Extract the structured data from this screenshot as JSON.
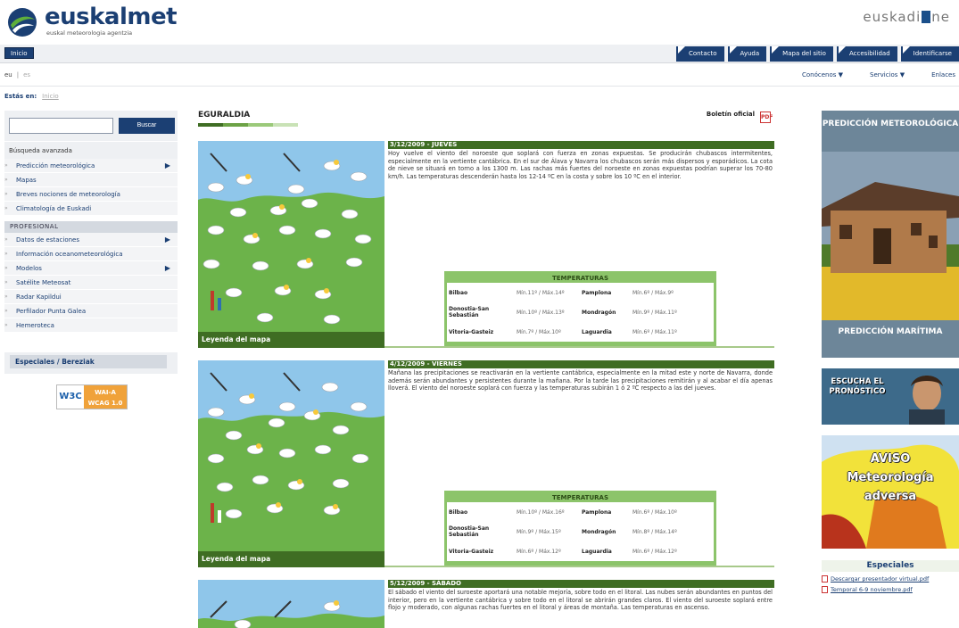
{
  "header": {
    "brand": "euskalmet",
    "tagline": "euskal meteorologia agentzia",
    "partner": "euskadi",
    "partner_tail": "ne"
  },
  "topbar": {
    "home_label": "Inicio",
    "nav": [
      "Contacto",
      "Ayuda",
      "Mapa del sitio",
      "Accesibilidad",
      "Identificarse"
    ]
  },
  "lang": {
    "current": "eu",
    "other": "es"
  },
  "subnav": [
    {
      "label": "Conócenos",
      "dropdown": true
    },
    {
      "label": "Servicios",
      "dropdown": true
    },
    {
      "label": "Enlaces",
      "dropdown": false
    }
  ],
  "breadcrumb": {
    "prefix": "Estás en:",
    "item": "Inicio"
  },
  "sidebar": {
    "search_placeholder": "",
    "search_button": "Buscar",
    "advanced_search": "Búsqueda avanzada",
    "menu": [
      {
        "label": "Predicción meteorológica",
        "has_submenu": true
      },
      {
        "label": "Mapas",
        "has_submenu": false
      },
      {
        "label": "Breves nociones de meteorología",
        "has_submenu": false
      },
      {
        "label": "Climatología de Euskadi",
        "has_submenu": false
      }
    ],
    "professional_heading": "PROFESIONAL",
    "professional_menu": [
      {
        "label": "Datos de estaciones",
        "has_submenu": true
      },
      {
        "label": "Información oceanometeorológica",
        "has_submenu": false
      },
      {
        "label": "Modelos",
        "has_submenu": true
      },
      {
        "label": "Satélite Meteosat",
        "has_submenu": false
      },
      {
        "label": "Radar Kapildui",
        "has_submenu": false
      },
      {
        "label": "Perfilador Punta Galea",
        "has_submenu": false
      },
      {
        "label": "Hemeroteca",
        "has_submenu": false
      }
    ],
    "especiales_heading": "Especiales / Bereziak",
    "wai_badge": {
      "w3c": "W3C",
      "level": "WAI-A",
      "version": "WCAG 1.0"
    }
  },
  "main": {
    "title": "EGURALDIA",
    "official_bulletin": "Boletín oficial",
    "map_legend": "Leyenda del mapa",
    "temps_heading": "TEMPERATURAS",
    "days": [
      {
        "date": "3/12/2009 - JUEVES",
        "text": "Hoy vuelve el viento del noroeste que soplará con fuerza en zonas expuestas. Se producirán chubascos intermitentes, especialmente en la vertiente cantábrica. En el sur de Álava y Navarra los chubascos serán más dispersos y esporádicos. La cota de nieve se situará en torno a los 1300 m. Las rachas más fuertes del noroeste en zonas expuestas podrían superar los 70-80 km/h. Las temperaturas descenderán hasta los 12-14 ºC en la costa y sobre los 10 ºC en el interior.",
        "temps": [
          [
            "Bilbao",
            "Mín.11º / Máx.14º",
            "Pamplona",
            "Mín.6º / Máx.9º"
          ],
          [
            "Donostia-San Sebastián",
            "Mín.10º / Máx.13º",
            "Mondragón",
            "Mín.9º / Máx.11º"
          ],
          [
            "Vitoria-Gasteiz",
            "Mín.7º / Máx.10º",
            "Laguardia",
            "Mín.6º / Máx.11º"
          ]
        ]
      },
      {
        "date": "4/12/2009 - VIERNES",
        "text": "Mañana las precipitaciones se reactivarán en la vertiente cantábrica, especialmente en la mitad este y norte de Navarra, donde además serán abundantes y persistentes durante la mañana. Por la tarde las precipitaciones remitirán y al acabar el día apenas lloverá. El viento del noroeste soplará con fuerza y las temperaturas subirán 1 ó 2 ºC respecto a las del jueves.",
        "temps": [
          [
            "Bilbao",
            "Mín.10º / Máx.16º",
            "Pamplona",
            "Mín.6º / Máx.10º"
          ],
          [
            "Donostia-San Sebastián",
            "Mín.9º / Máx.15º",
            "Mondragón",
            "Mín.8º / Máx.14º"
          ],
          [
            "Vitoria-Gasteiz",
            "Mín.6º / Máx.12º",
            "Laguardia",
            "Mín.6º / Máx.12º"
          ]
        ]
      },
      {
        "date": "5/12/2009 - SÁBADO",
        "text": "El sábado el viento del suroeste aportará una notable mejoría, sobre todo en el litoral. Las nubes serán abundantes en puntos del interior, pero en la vertiente cantábrica y sobre todo en el litoral se abrirán grandes claros. El viento del suroeste soplará entre flojo y moderado, con algunas rachas fuertes en el litoral y áreas de montaña. Las temperaturas en ascenso."
      }
    ]
  },
  "right": {
    "prediction_top": "PREDICCIÓN METEOROLÓGICA",
    "prediction_bottom": "PREDICCIÓN MARÍTIMA",
    "listen": "ESCUCHA EL PRONÓSTICO",
    "alert_title": "AVISO",
    "alert_sub": "Meteorología adversa",
    "specials_title": "Especiales",
    "links": [
      "Descargar presentador virtual.pdf",
      "Temporal 6-9 noviembre.pdf"
    ]
  },
  "colors": {
    "brand_blue": "#1b3f73",
    "map_green": "#6cb34a",
    "dark_green": "#3f6d23",
    "temps_green": "#8cc46a",
    "sea_blue": "#8fc6ea"
  }
}
